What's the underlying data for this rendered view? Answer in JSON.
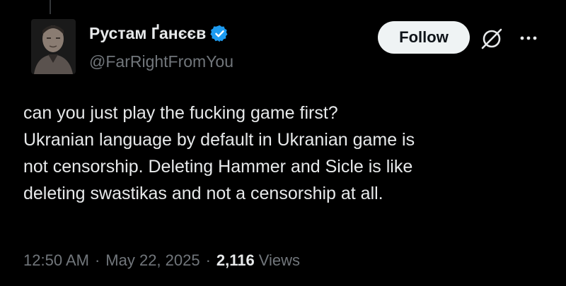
{
  "author": {
    "display_name": "Рустам Ґанєєв",
    "handle": "@FarRightFromYou",
    "verified": true
  },
  "actions": {
    "follow_label": "Follow",
    "icons": [
      "grok-icon",
      "more-icon"
    ]
  },
  "tweet": {
    "lines": [
      "can you just play the fucking game first?",
      "Ukranian language by default in Ukranian game is",
      "not censorship. Deleting Hammer and Sicle is like",
      "deleting swastikas and not a censorship at all."
    ]
  },
  "meta": {
    "time": "12:50 AM",
    "separator": "·",
    "date": "May 22, 2025",
    "views_count": "2,116",
    "views_label": "Views"
  },
  "colors": {
    "background": "#000000",
    "text": "#e7e9ea",
    "secondary_text": "#71767b",
    "verified_badge": "#1d9bf0",
    "follow_bg": "#eff3f4"
  }
}
